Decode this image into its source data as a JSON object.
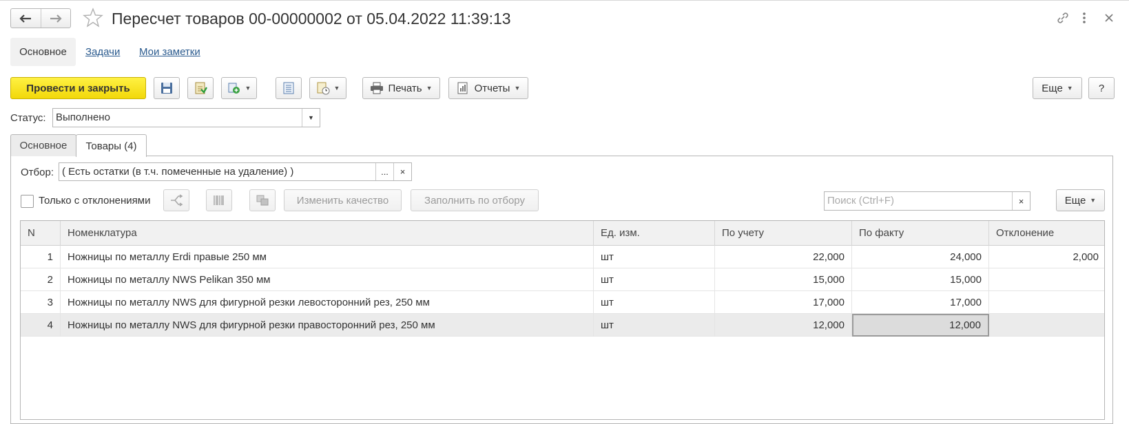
{
  "header": {
    "title": "Пересчет товаров 00-00000002 от 05.04.2022 11:39:13"
  },
  "page_tabs": {
    "active": "Основное",
    "links": [
      "Задачи",
      "Мои заметки"
    ]
  },
  "toolbar": {
    "post_close": "Провести и закрыть",
    "print": "Печать",
    "reports": "Отчеты",
    "more": "Еще",
    "help": "?"
  },
  "status": {
    "label": "Статус:",
    "value": "Выполнено"
  },
  "inner_tabs": [
    "Основное",
    "Товары (4)"
  ],
  "filter": {
    "label": "Отбор:",
    "value": "( Есть остатки (в т.ч. помеченные на удаление) )",
    "ellipsis": "...",
    "clear": "×"
  },
  "goods_toolbar": {
    "only_deviations": "Только с отклонениями",
    "change_quality": "Изменить качество",
    "fill_by_filter": "Заполнить по отбору",
    "search_placeholder": "Поиск (Ctrl+F)",
    "search_clear": "×",
    "more": "Еще"
  },
  "table": {
    "columns": [
      "N",
      "Номенклатура",
      "Ед. изм.",
      "По учету",
      "По факту",
      "Отклонение"
    ],
    "rows": [
      {
        "n": "1",
        "name": "Ножницы по металлу Erdi правые 250 мм",
        "unit": "шт",
        "book": "22,000",
        "fact": "24,000",
        "dev": "2,000"
      },
      {
        "n": "2",
        "name": "Ножницы по металлу NWS Pelikan 350 мм",
        "unit": "шт",
        "book": "15,000",
        "fact": "15,000",
        "dev": ""
      },
      {
        "n": "3",
        "name": "Ножницы по металлу NWS для фигурной резки левосторонний рез, 250 мм",
        "unit": "шт",
        "book": "17,000",
        "fact": "17,000",
        "dev": ""
      },
      {
        "n": "4",
        "name": "Ножницы по металлу NWS для фигурной резки правосторонний рез, 250 мм",
        "unit": "шт",
        "book": "12,000",
        "fact": "12,000",
        "dev": ""
      }
    ]
  },
  "colors": {
    "primary_button": "#f2d80a",
    "link": "#2a5a8e"
  }
}
